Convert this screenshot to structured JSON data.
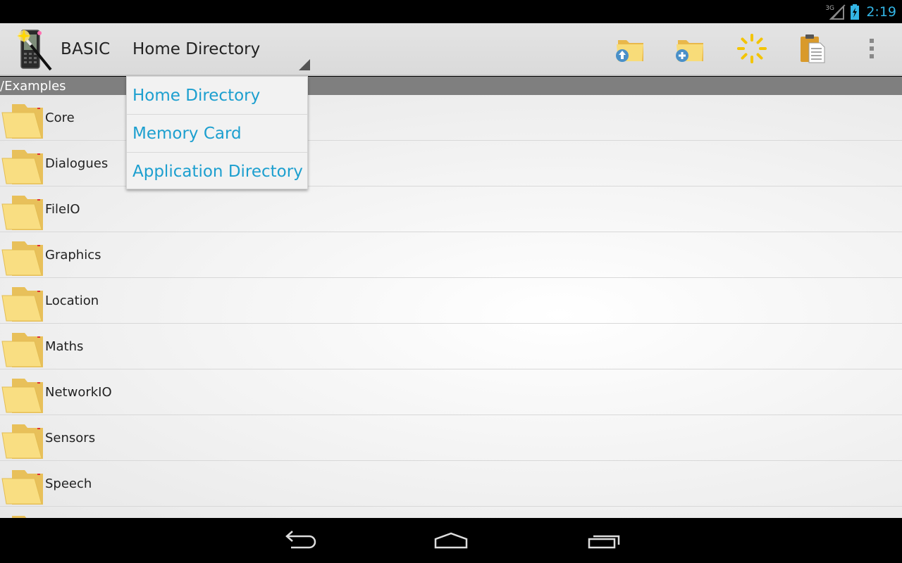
{
  "status_bar": {
    "network": "3G",
    "time": "2:19"
  },
  "action_bar": {
    "app_title": "BASIC",
    "spinner_selected": "Home Directory",
    "actions": [
      {
        "icon": "folder-up-icon"
      },
      {
        "icon": "new-folder-icon"
      },
      {
        "icon": "refresh-sun-icon"
      },
      {
        "icon": "clipboard-paste-icon"
      },
      {
        "icon": "overflow-menu-icon"
      }
    ]
  },
  "path": "/Examples",
  "dropdown": {
    "options": [
      "Home Directory",
      "Memory Card",
      "Application Directory"
    ]
  },
  "files": [
    {
      "name": "Core"
    },
    {
      "name": "Dialogues"
    },
    {
      "name": "FileIO"
    },
    {
      "name": "Graphics"
    },
    {
      "name": "Location"
    },
    {
      "name": "Maths"
    },
    {
      "name": "NetworkIO"
    },
    {
      "name": "Sensors"
    },
    {
      "name": "Speech"
    },
    {
      "name": ""
    }
  ],
  "colors": {
    "accent": "#33b5e5",
    "dropdown_text": "#1c9fcf",
    "path_bar": "#7f7f7f",
    "folder": "#f7d773"
  },
  "nav": [
    "back-icon",
    "home-icon",
    "recent-apps-icon"
  ]
}
